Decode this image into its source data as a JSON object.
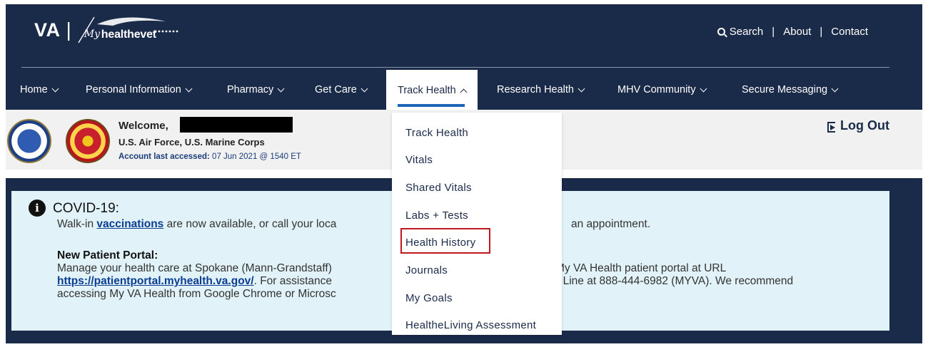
{
  "brand": {
    "va": "VA",
    "separator": "|",
    "my": "My",
    "healthevet": "healthevet"
  },
  "utility": {
    "search_label": "Search",
    "about_label": "About",
    "contact_label": "Contact",
    "pipe": "|"
  },
  "nav": {
    "items": [
      {
        "label": "Home"
      },
      {
        "label": "Personal Information"
      },
      {
        "label": "Pharmacy"
      },
      {
        "label": "Get Care"
      },
      {
        "label": "Track Health"
      },
      {
        "label": "Research Health"
      },
      {
        "label": "MHV Community"
      },
      {
        "label": "Secure Messaging"
      }
    ],
    "active_index": 4
  },
  "welcome": {
    "greeting": "Welcome,",
    "branches": "U.S. Air Force, U.S. Marine Corps",
    "last_accessed_label": "Account last accessed:",
    "last_accessed_value": "07 Jun 2021 @ 1540 ET",
    "logout_label": "Log Out"
  },
  "alert": {
    "title": "COVID-19:",
    "line1_prefix": "Walk-in ",
    "line1_link": "vaccinations",
    "line1_mid": " are now available, or call your loca",
    "line1_suffix": "an appointment.",
    "subtitle": "New Patient Portal:",
    "line2_a": "Manage your health care at Spokane (Mann-Grandstaff)",
    "line2_b": "My VA Health patient portal at URL",
    "line3_link": "https://patientportal.myhealth.va.gov/",
    "line3_a": ". For assistance",
    "line3_b": "t Line at 888-444-6982 (MYVA). We recommend",
    "line4": "accessing My VA Health from Google Chrome or Microsc"
  },
  "dropdown": {
    "items": [
      {
        "label": "Track Health"
      },
      {
        "label": "Vitals"
      },
      {
        "label": "Shared Vitals"
      },
      {
        "label": "Labs + Tests"
      },
      {
        "label": "Health History"
      },
      {
        "label": "Journals"
      },
      {
        "label": "My Goals"
      },
      {
        "label": "HealtheLiving Assessment"
      }
    ],
    "highlighted_index": 4
  },
  "colors": {
    "header": "#1a2a49",
    "accent": "#1b64b6",
    "alert_bg": "#e1f3f8",
    "highlight": "#c0181f"
  }
}
